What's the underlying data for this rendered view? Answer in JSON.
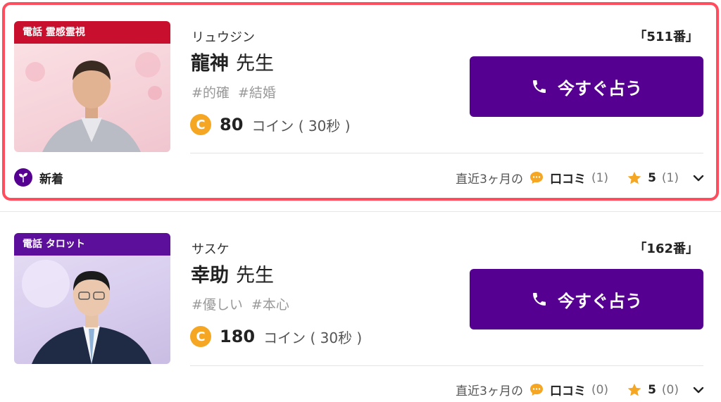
{
  "cards": [
    {
      "category": "電話 霊感霊視",
      "reading": "リュウジン",
      "name": "龍神",
      "title": "先生",
      "tags": [
        "#的確",
        "#結婚"
      ],
      "coin_symbol": "C",
      "price": "80",
      "price_unit": "コイン ( 30秒 )",
      "rank": "「511番」",
      "button_label": "今すぐ占う",
      "new_label": "新着",
      "recent_label": "直近3ヶ月の",
      "review_label": "口コミ",
      "review_count": "(1)",
      "rating": "5",
      "rating_count": "(1)",
      "highlighted": true
    },
    {
      "category": "電話 タロット",
      "reading": "サスケ",
      "name": "幸助",
      "title": "先生",
      "tags": [
        "#優しい",
        "#本心"
      ],
      "coin_symbol": "C",
      "price": "180",
      "price_unit": "コイン ( 30秒 )",
      "rank": "「162番」",
      "button_label": "今すぐ占う",
      "recent_label": "直近3ヶ月の",
      "review_label": "口コミ",
      "review_count": "(0)",
      "rating": "5",
      "rating_count": "(0)",
      "highlighted": false
    }
  ],
  "colors": {
    "primary": "#560092",
    "highlight_border": "#ff4d5e",
    "coin": "#f5a623",
    "category_red": "#c8102e",
    "category_purple": "#5b0f9a",
    "star": "#f5a623"
  }
}
